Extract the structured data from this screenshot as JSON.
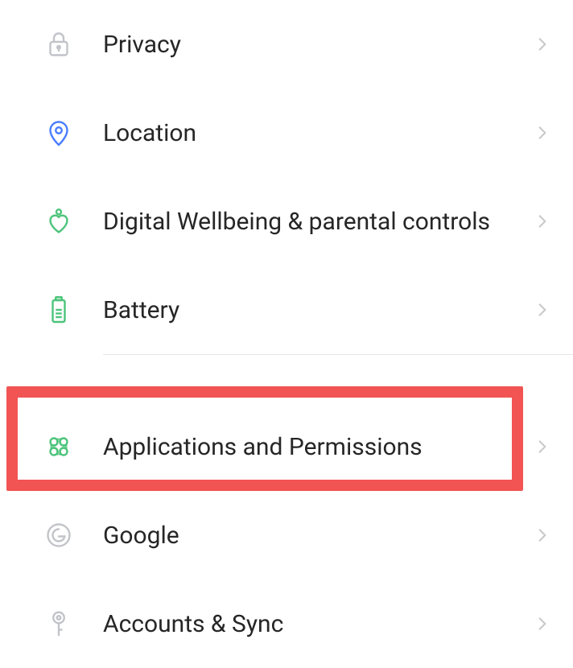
{
  "group1": [
    {
      "key": "privacy",
      "icon": "lock-icon",
      "label": "Privacy"
    },
    {
      "key": "location",
      "icon": "location-pin-icon",
      "label": "Location"
    },
    {
      "key": "wellbeing",
      "icon": "wellbeing-icon",
      "label": "Digital Wellbeing & parental controls"
    },
    {
      "key": "battery",
      "icon": "battery-icon",
      "label": "Battery"
    }
  ],
  "group2": [
    {
      "key": "apps",
      "icon": "apps-icon",
      "label": "Applications and Permissions"
    },
    {
      "key": "google",
      "icon": "google-icon",
      "label": "Google"
    },
    {
      "key": "accounts",
      "icon": "key-icon",
      "label": "Accounts & Sync"
    }
  ],
  "highlighted": "apps",
  "colors": {
    "grey": "#c2c4c9",
    "blue": "#4a7dff",
    "green": "#4cc47a",
    "chevron": "#c9c9c9",
    "highlight": "#f25353"
  }
}
